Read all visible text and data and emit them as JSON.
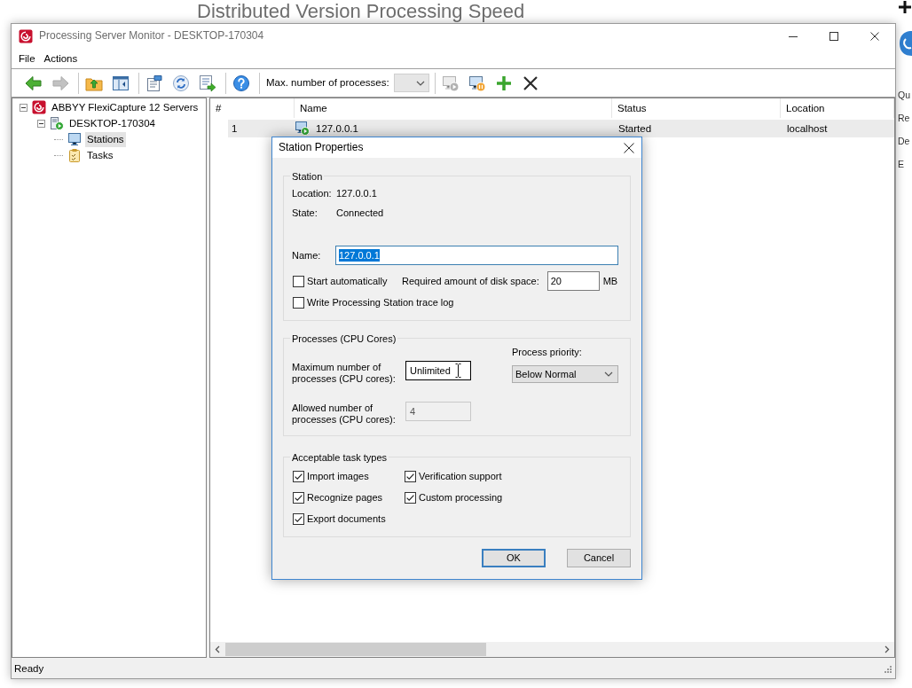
{
  "background_page": {
    "heading": "Distributed Version Processing Speed",
    "edge_texts": [
      "Qu",
      "Re",
      "De",
      "E"
    ]
  },
  "window": {
    "title": "Processing Server Monitor - DESKTOP-170304"
  },
  "menu": [
    "File",
    "Actions"
  ],
  "toolbar": {
    "items": [
      {
        "kind": "button",
        "disabled": false
      },
      {
        "kind": "button",
        "disabled": true
      },
      {
        "kind": "separator"
      },
      {
        "kind": "button",
        "disabled": false
      },
      {
        "kind": "button",
        "disabled": false
      },
      {
        "kind": "separator"
      },
      {
        "kind": "button",
        "disabled": false
      },
      {
        "kind": "button",
        "disabled": false
      },
      {
        "kind": "button",
        "disabled": false
      },
      {
        "kind": "separator"
      },
      {
        "kind": "button",
        "disabled": false
      },
      {
        "kind": "separator"
      },
      {
        "kind": "label",
        "text": "Max. number of processes:"
      },
      {
        "kind": "combo",
        "disabled": true
      },
      {
        "kind": "separator"
      },
      {
        "kind": "button",
        "disabled": true
      },
      {
        "kind": "button",
        "disabled": false
      },
      {
        "kind": "button",
        "disabled": false
      },
      {
        "kind": "button",
        "disabled": false
      }
    ]
  },
  "tree": [
    {
      "kind": "servers",
      "label": "ABBYY FlexiCapture 12 Servers",
      "expanded": true,
      "selected": false,
      "children": [
        {
          "kind": "server",
          "label": "DESKTOP-170304",
          "expanded": true,
          "selected": false,
          "children": [
            {
              "kind": "stations",
              "label": "Stations",
              "selected": true
            },
            {
              "kind": "tasks",
              "label": "Tasks",
              "selected": false
            }
          ]
        }
      ]
    }
  ],
  "list": {
    "columns": [
      "#",
      "Name",
      "Status",
      "Location"
    ],
    "rows": [
      {
        "selected": true,
        "cells": [
          "1",
          "127.0.0.1",
          "Started",
          "localhost"
        ]
      }
    ]
  },
  "status_bar": {
    "text": "Ready"
  },
  "dialog": {
    "title": "Station Properties",
    "station_group": {
      "legend": "Station",
      "info": [
        {
          "label": "Location:",
          "value": "127.0.0.1"
        },
        {
          "label": "State:",
          "value": "Connected"
        }
      ],
      "name": {
        "label": "Name:",
        "value": "127.0.0.1",
        "text_selected": true
      },
      "start_automatically": {
        "label": "Start automatically",
        "checked": false
      },
      "disk_space": {
        "label": "Required amount of disk space:",
        "value": "20",
        "unit": "MB"
      },
      "trace_log": {
        "label": "Write Processing Station trace log",
        "checked": false
      }
    },
    "processes_group": {
      "legend": "Processes (CPU Cores)",
      "maximum": {
        "label": "Maximum number of processes (CPU cores):",
        "value": "Unlimited"
      },
      "allowed": {
        "label": "Allowed number of processes (CPU cores):",
        "value": "4",
        "disabled": true
      },
      "priority": {
        "label": "Process priority:",
        "value": "Below Normal"
      }
    },
    "task_types_group": {
      "legend": "Acceptable task types",
      "items": [
        {
          "label": "Import images",
          "checked": true
        },
        {
          "label": "Verification support",
          "checked": true
        },
        {
          "label": "Recognize pages",
          "checked": true
        },
        {
          "label": "Custom processing",
          "checked": true
        },
        {
          "label": "Export documents",
          "checked": true
        }
      ]
    },
    "buttons": [
      {
        "label": "OK",
        "default": true
      },
      {
        "label": "Cancel",
        "default": false
      }
    ]
  }
}
